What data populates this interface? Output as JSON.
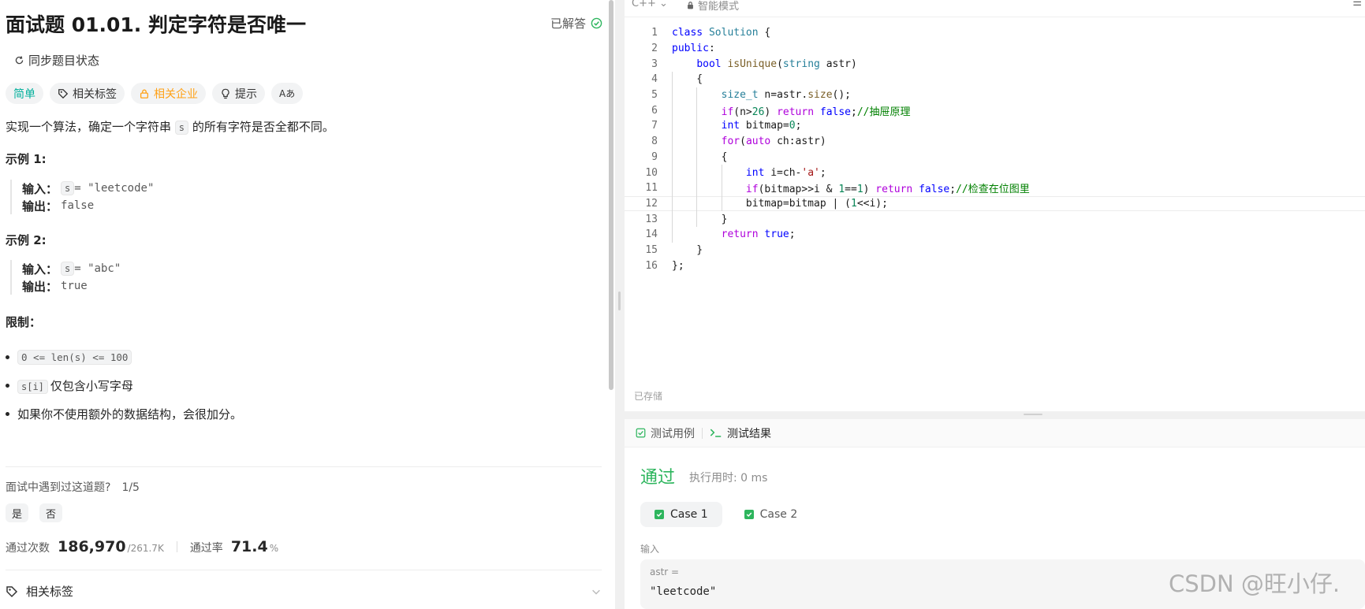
{
  "problem": {
    "title": "面试题 01.01. 判定字符是否唯一",
    "status": "已解答",
    "sync_label": "同步题目状态",
    "tags": {
      "difficulty": "简单",
      "related_tags": "相关标签",
      "company": "相关企业",
      "hint": "提示",
      "translate": "Aあ"
    },
    "desc_pre": "实现一个算法，确定一个字符串",
    "desc_code": "s",
    "desc_post": "的所有字符是否全都不同。",
    "examples": [
      {
        "heading": "示例 1:",
        "input_label": "输入：",
        "var": "s",
        "input_rest": " = \"leetcode\"",
        "output_label": "输出：",
        "output": "false"
      },
      {
        "heading": "示例 2:",
        "input_label": "输入：",
        "var": "s",
        "input_rest": " = \"abc\"",
        "output_label": "输出：",
        "output": "true"
      }
    ],
    "constraints_heading": "限制：",
    "constraints": [
      {
        "code": "0 <= len(s) <= 100",
        "text": ""
      },
      {
        "code": "s[i]",
        "text": "仅包含小写字母"
      },
      {
        "code": "",
        "text": "如果你不使用额外的数据结构，会很加分。"
      }
    ],
    "met_question": "面试中遇到过这道题?",
    "met_count": "1/5",
    "yes": "是",
    "no": "否",
    "submissions_label": "通过次数",
    "submissions_value": "186,970",
    "submissions_total": "/261.7K",
    "rate_label": "通过率",
    "rate_value": "71.4",
    "rate_unit": "%",
    "related_tags_footer": "相关标签"
  },
  "editor": {
    "language": "C++",
    "mode": "智能模式",
    "saved_label": "已存储",
    "lines": [
      "class Solution {",
      "public:",
      "    bool isUnique(string astr)",
      "    {",
      "        size_t n=astr.size();",
      "        if(n>26) return false;//抽屉原理",
      "        int bitmap=0;",
      "        for(auto ch:astr)",
      "        {",
      "            int i=ch-'a';",
      "            if(bitmap>>i & 1==1) return false;//检查在位图里",
      "            bitmap=bitmap | (1<<i);",
      "        }",
      "        return true;",
      "    }",
      "};"
    ],
    "line_numbers": [
      "1",
      "2",
      "3",
      "4",
      "5",
      "6",
      "7",
      "8",
      "9",
      "10",
      "11",
      "12",
      "13",
      "14",
      "15",
      "16"
    ]
  },
  "result": {
    "tab_testcase": "测试用例",
    "tab_result": "测试结果",
    "status": "通过",
    "runtime": "执行用时: 0 ms",
    "cases": [
      "Case 1",
      "Case 2"
    ],
    "input_label": "输入",
    "var_label": "astr =",
    "var_value": "\"leetcode\""
  },
  "watermark": "CSDN @旺小仔.",
  "colors": {
    "accent_green": "#2db55d",
    "easy": "#00af9b",
    "company": "#ffa116"
  }
}
